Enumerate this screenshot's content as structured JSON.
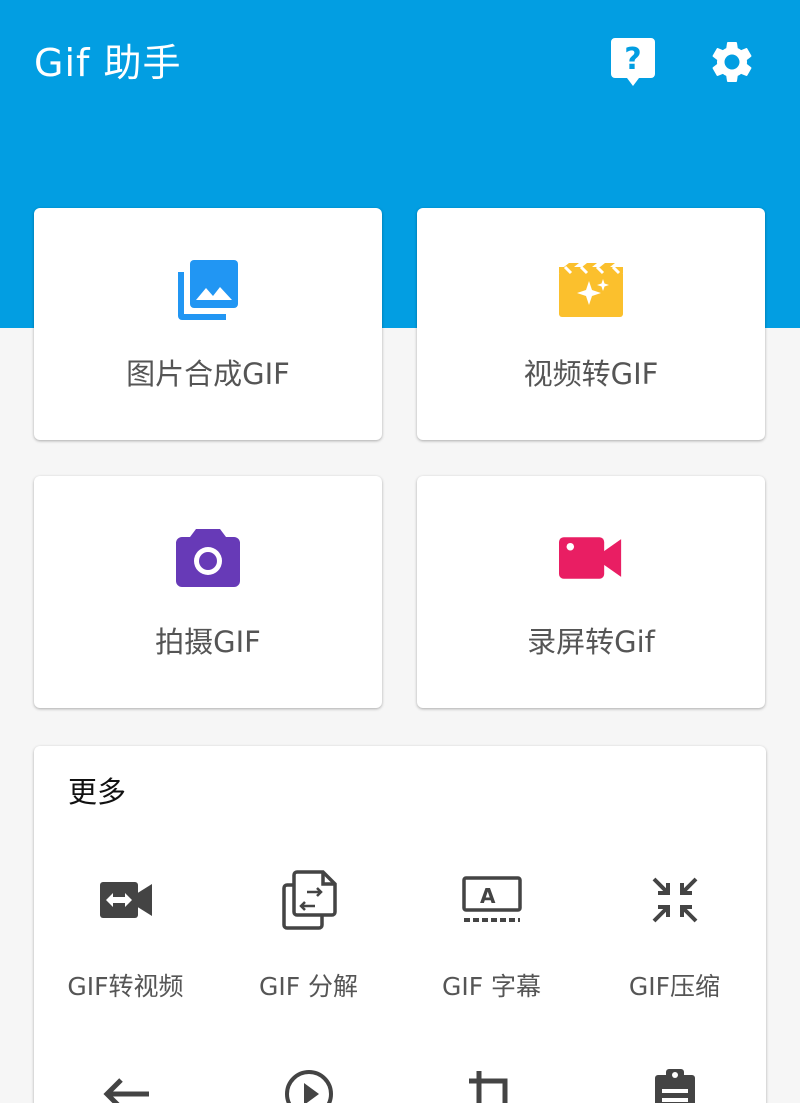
{
  "app": {
    "title": "Gif 助手",
    "header_color": "#029ee2"
  },
  "toolbar": {
    "help_icon": "help-icon",
    "settings_icon": "gear-icon"
  },
  "cards": [
    {
      "label": "图片合成GIF",
      "icon": "photo-library-icon",
      "color": "#2196f3"
    },
    {
      "label": "视频转GIF",
      "icon": "movie-sparkle-icon",
      "color": "#fbc02d"
    },
    {
      "label": "拍摄GIF",
      "icon": "camera-icon",
      "color": "#673ab7"
    },
    {
      "label": "录屏转Gif",
      "icon": "videocam-icon",
      "color": "#e91e63"
    }
  ],
  "more": {
    "title": "更多",
    "tools": [
      {
        "label": "GIF转视频",
        "icon": "gif-to-video-icon"
      },
      {
        "label": "GIF 分解",
        "icon": "split-file-icon"
      },
      {
        "label": "GIF 字幕",
        "icon": "subtitle-icon"
      },
      {
        "label": "GIF压缩",
        "icon": "compress-icon"
      }
    ],
    "tools_row2": [
      {
        "icon": "arrow-back-icon"
      },
      {
        "icon": "play-circle-icon"
      },
      {
        "icon": "crop-icon"
      },
      {
        "icon": "clipboard-icon"
      }
    ]
  }
}
